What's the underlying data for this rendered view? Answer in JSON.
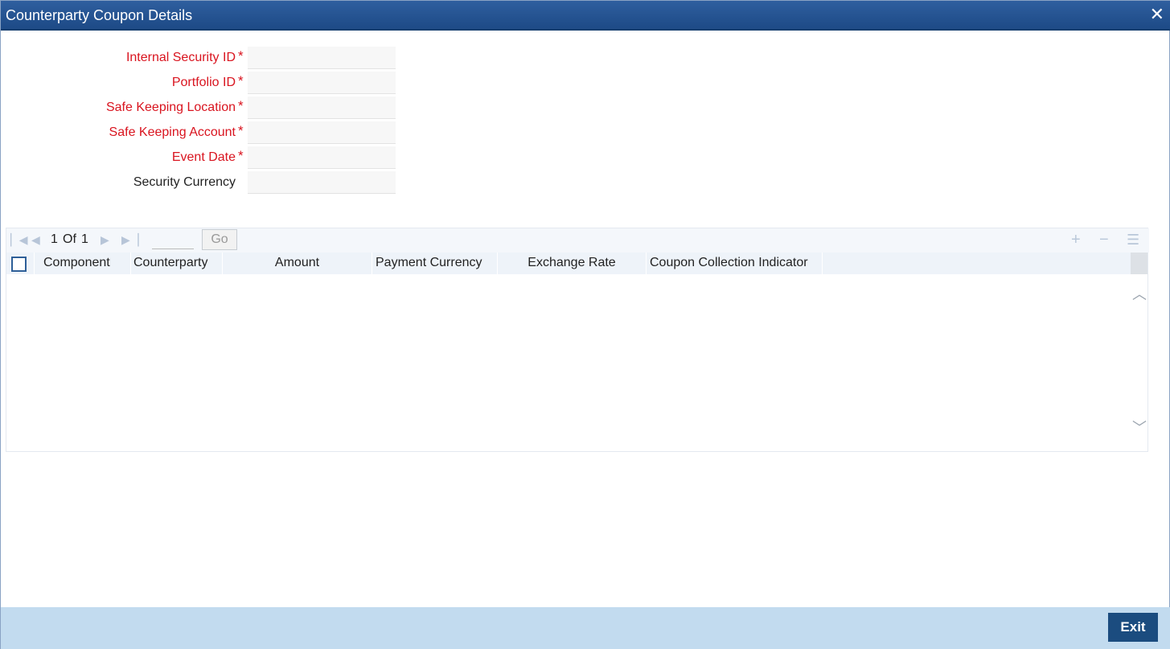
{
  "window": {
    "title": "Counterparty Coupon Details",
    "close_glyph": "✕"
  },
  "form": {
    "fields": [
      {
        "label": "Internal Security ID",
        "required": "*",
        "value": ""
      },
      {
        "label": "Portfolio ID",
        "required": "*",
        "value": ""
      },
      {
        "label": "Safe Keeping Location",
        "required": "*",
        "value": ""
      },
      {
        "label": "Safe Keeping Account",
        "required": "*",
        "value": ""
      },
      {
        "label": "Event Date",
        "required": "*",
        "value": ""
      },
      {
        "label": "Security Currency",
        "value": ""
      }
    ]
  },
  "grid": {
    "pager": {
      "current": "1",
      "of_label": "Of",
      "total": "1",
      "go_label": "Go"
    },
    "toolbar_icons": [
      "plus-icon",
      "minus-icon",
      "list-icon"
    ],
    "columns": [
      "Component",
      "Counterparty",
      "Amount",
      "Payment Currency",
      "Exchange Rate",
      "Coupon Collection Indicator"
    ],
    "rows": []
  },
  "footer": {
    "exit_label": "Exit"
  },
  "colors": {
    "title_bar": "#1d4a86",
    "required_label": "#d9141f",
    "footer": "#c2dbef",
    "exit_button": "#1b4c7f"
  }
}
